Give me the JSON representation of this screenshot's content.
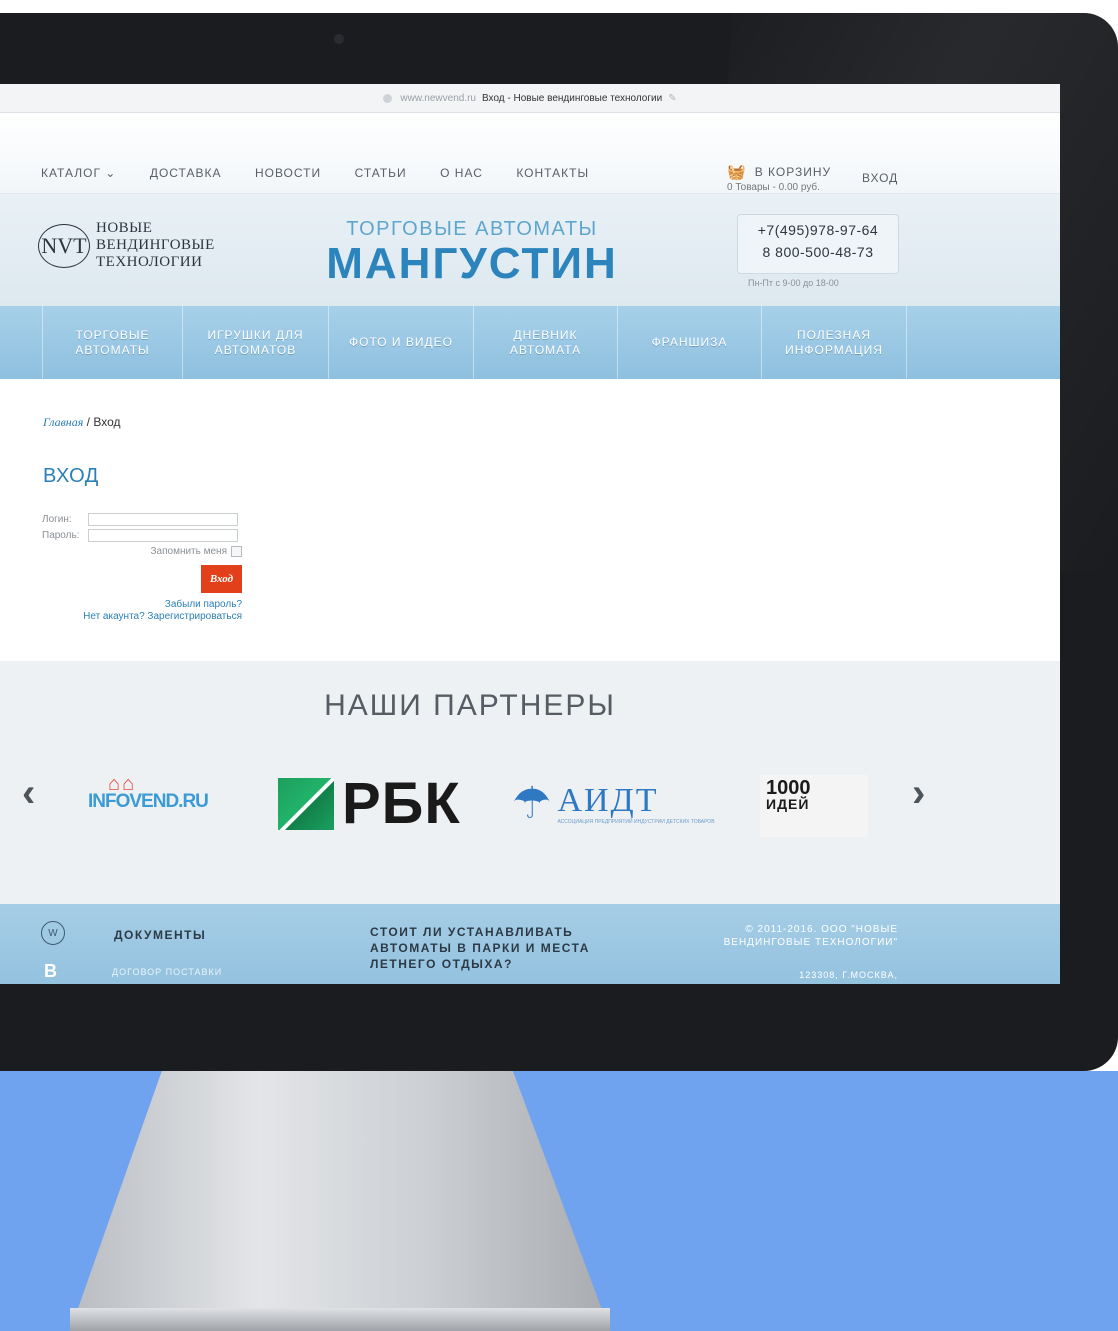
{
  "browser": {
    "domain": "www.newvend.ru",
    "page_title": "Вход - Новые вендинговые технологии"
  },
  "topnav": {
    "items": [
      "КАТАЛОГ ⌄",
      "ДОСТАВКА",
      "НОВОСТИ",
      "СТАТЬИ",
      "О НАС",
      "КОНТАКТЫ"
    ],
    "cart_label": "В КОРЗИНУ",
    "cart_summary": "0 Товары - 0.00 руб.",
    "login_label": "ВХОД"
  },
  "header": {
    "logo_mark": "NVT",
    "logo_lines": [
      "НОВЫЕ",
      "ВЕНДИНГОВЫЕ",
      "ТЕХНОЛОГИИ"
    ],
    "brand_sub": "ТОРГОВЫЕ АВТОМАТЫ",
    "brand_main": "МАНГУСТИН",
    "phone1": "+7(495)978-97-64",
    "phone2": "8 800-500-48-73",
    "hours": "Пн-Пт с 9-00 до 18-00"
  },
  "mainnav": {
    "items": [
      {
        "l1": "ТОРГОВЫЕ",
        "l2": "АВТОМАТЫ"
      },
      {
        "l1": "ИГРУШКИ ДЛЯ",
        "l2": "АВТОМАТОВ"
      },
      {
        "l1": "ФОТО И ВИДЕО",
        "l2": ""
      },
      {
        "l1": "ДНЕВНИК",
        "l2": "АВТОМАТА"
      },
      {
        "l1": "ФРАНШИЗА",
        "l2": ""
      },
      {
        "l1": "ПОЛЕЗНАЯ",
        "l2": "ИНФОРМАЦИЯ"
      }
    ]
  },
  "breadcrumb": {
    "home": "Главная",
    "separator": "/",
    "current": "Вход"
  },
  "login": {
    "title": "ВХОД",
    "login_label": "Логин:",
    "password_label": "Пароль:",
    "login_value": "",
    "password_value": "",
    "remember_label": "Запомнить меня",
    "submit_label": "Вход",
    "forgot_link": "Забыли пароль?",
    "register_link": "Нет акаунта? Зарегистрироваться"
  },
  "partners": {
    "title": "НАШИ ПАРТНЕРЫ",
    "prev_icon": "chevron-left-icon",
    "next_icon": "chevron-right-icon",
    "infovend": "INFOVEND.RU",
    "rbk": "РБК",
    "aidt": "АИДТ",
    "aidt_desc": "АССОЦИАЦИЯ ПРЕДПРИЯТИЙ ИНДУСТРИИ ДЕТСКИХ ТОВАРОВ",
    "ideas_num": "1000",
    "ideas_word": "ИДЕЙ"
  },
  "footer": {
    "docs_title": "ДОКУМЕНТЫ",
    "doc_item": "ДОГОВОР ПОСТАВКИ",
    "article": "СТОИТ ЛИ УСТАНАВЛИВАТЬ АВТОМАТЫ В ПАРКИ И МЕСТА ЛЕТНЕГО ОТДЫХА?",
    "copyright": "© 2011-2016. ООО \"НОВЫЕ ВЕНДИНГОВЫЕ ТЕХНОЛОГИИ\"",
    "address": "123308, Г.МОСКВА,",
    "social2": "В"
  }
}
